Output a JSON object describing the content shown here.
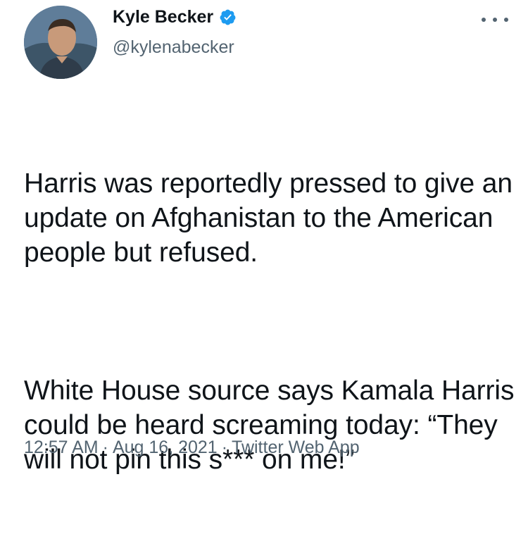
{
  "author": {
    "display_name": "Kyle Becker",
    "handle": "@kylenabecker",
    "verified": true,
    "avatar_icon": "avatar"
  },
  "tweet": {
    "paragraphs": [
      "Harris was reportedly pressed to give an update on Afghanistan to the American people but refused.",
      "White House source says Kamala Harris could be heard screaming today: “They will not pin this s*** on me!”"
    ]
  },
  "meta": {
    "time": "12:57 AM",
    "separator": "·",
    "date": "Aug 16, 2021",
    "source": "Twitter Web App"
  },
  "colors": {
    "text": "#0f1419",
    "secondary": "#536471",
    "verified_blue": "#1d9bf0"
  },
  "icons": {
    "verified": "verified-badge-icon",
    "more": "more-options-icon"
  }
}
